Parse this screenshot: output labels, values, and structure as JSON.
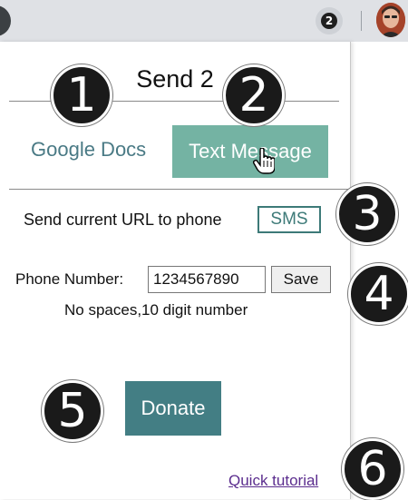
{
  "toolbar": {
    "extension_badge": "2",
    "extension_icon": "send2-extension-icon",
    "avatar_icon": "profile-avatar-icon"
  },
  "popup": {
    "title": "Send 2",
    "tabs": [
      {
        "label": "Google Docs",
        "active": false
      },
      {
        "label": "Text Message",
        "active": true
      }
    ],
    "sms_section": {
      "label": "Send current URL to phone",
      "button_label": "SMS"
    },
    "phone": {
      "label": "Phone Number:",
      "value": "1234567890",
      "save_label": "Save",
      "hint": "No spaces,10 digit number"
    },
    "donate_label": "Donate",
    "tutorial_link": "Quick tutorial"
  },
  "markers": [
    "1",
    "2",
    "3",
    "4",
    "5",
    "6"
  ],
  "colors": {
    "tab_active_bg": "#74b3a3",
    "tab_inactive_text": "#4a7a85",
    "sms_border": "#3d7a78",
    "donate_bg": "#437e84",
    "link": "#5b2d8e"
  }
}
